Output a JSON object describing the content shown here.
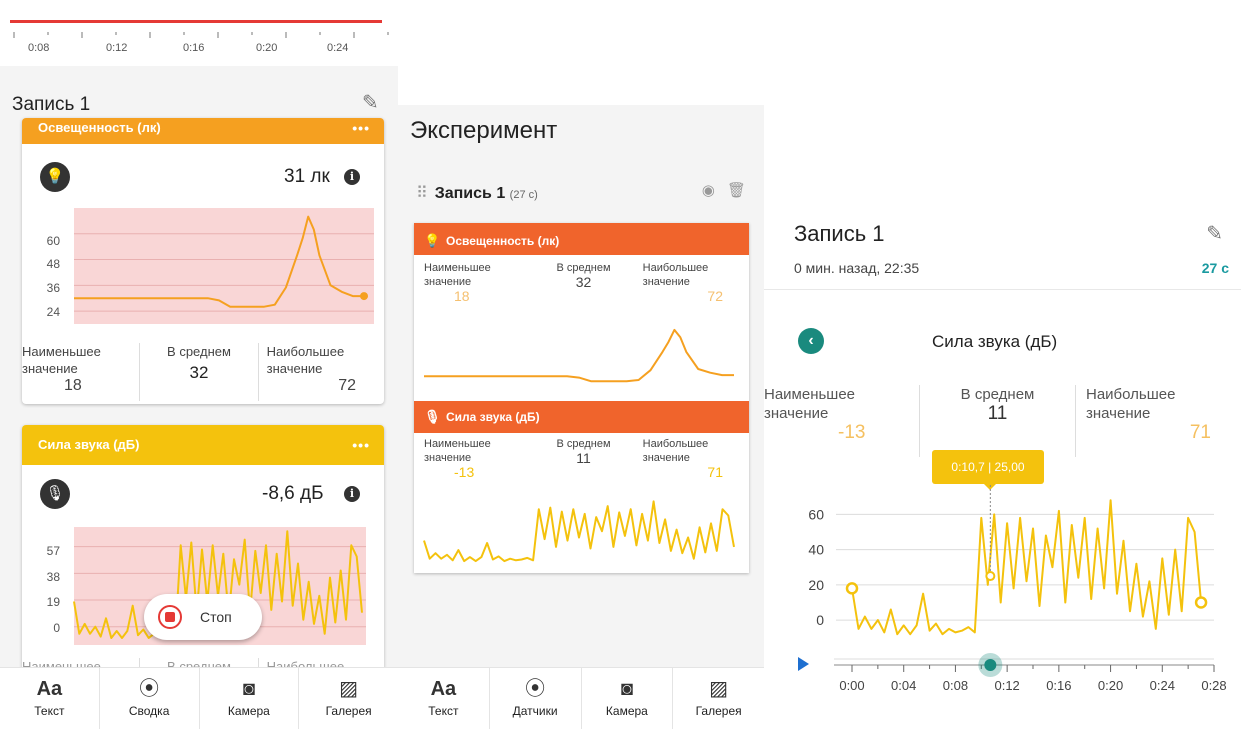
{
  "colors": {
    "light_orange": "#f5a020",
    "light_line": "#f5a020",
    "sound_yellow": "#f4c20d",
    "sound_line": "#f4c20d",
    "alert_band": "#f9d6d6",
    "section_orange": "#f0642c",
    "teal": "#1a8a7e",
    "record_red": "#e53935"
  },
  "panel1": {
    "timeline_ticks": [
      "0:08",
      "0:12",
      "0:16",
      "0:20",
      "0:24"
    ],
    "recording_title": "Запись 1",
    "light_card": {
      "title": "Освещенность (лк)",
      "menu": "•••",
      "icon": "lightbulb-icon",
      "reading": "31 лк",
      "y_ticks": [
        "60",
        "48",
        "36",
        "24"
      ],
      "stats": [
        {
          "label": "Наименьшее значение",
          "value": "18"
        },
        {
          "label": "В среднем",
          "value": "32"
        },
        {
          "label": "Наибольшее значение",
          "value": "72"
        }
      ]
    },
    "sound_card": {
      "title": "Сила звука (дБ)",
      "menu": "•••",
      "icon": "microphone-icon",
      "reading": "-8,6 дБ",
      "y_ticks": [
        "57",
        "38",
        "19",
        "0"
      ],
      "stats": [
        {
          "label": "Наименьшее",
          "value": ""
        },
        {
          "label": "В среднем",
          "value": ""
        },
        {
          "label": "Наибольшее",
          "value": ""
        }
      ]
    },
    "stop_button": "Стоп",
    "tabs": [
      {
        "icon": "text-icon",
        "glyph": "Aa",
        "label": "Текст"
      },
      {
        "icon": "sensor-summary-icon",
        "glyph": "⦿",
        "label": "Сводка"
      },
      {
        "icon": "camera-icon",
        "glyph": "◙",
        "label": "Камера"
      },
      {
        "icon": "gallery-icon",
        "glyph": "▨",
        "label": "Галерея"
      }
    ]
  },
  "panel2": {
    "title": "Эксперимент",
    "recording_title": "Запись 1",
    "recording_duration": "(27 с)",
    "light_section": {
      "title": "Освещенность (лк)",
      "stats": [
        {
          "label": "Наименьшее значение",
          "value": "18"
        },
        {
          "label": "В среднем",
          "value": "32"
        },
        {
          "label": "Наибольшее значение",
          "value": "72"
        }
      ]
    },
    "sound_section": {
      "title": "Сила звука (дБ)",
      "stats": [
        {
          "label": "Наименьшее значение",
          "value": "-13"
        },
        {
          "label": "В среднем",
          "value": "11"
        },
        {
          "label": "Наибольшее значение",
          "value": "71"
        }
      ]
    },
    "tabs": [
      {
        "icon": "text-icon",
        "glyph": "Aa",
        "label": "Текст"
      },
      {
        "icon": "sensors-icon",
        "glyph": "⦿",
        "label": "Датчики"
      },
      {
        "icon": "camera-icon",
        "glyph": "◙",
        "label": "Камера"
      },
      {
        "icon": "gallery-icon",
        "glyph": "▨",
        "label": "Галерея"
      }
    ]
  },
  "panel3": {
    "recording_title": "Запись 1",
    "subtitle": "0 мин. назад, 22:35",
    "duration": "27 с",
    "chart_title": "Сила звука (дБ)",
    "stats": [
      {
        "label": "Наименьшее значение",
        "value": "-13"
      },
      {
        "label": "В среднем",
        "value": "11"
      },
      {
        "label": "Наибольшее значение",
        "value": "71"
      }
    ],
    "tooltip": "0:10,7  |  25,00"
  },
  "chart_data": [
    {
      "type": "line",
      "title": "Освещенность (лк)",
      "x_unit": "s",
      "ylim": [
        18,
        72
      ],
      "y_ticks": [
        24,
        36,
        48,
        60
      ],
      "x": [
        0,
        4,
        8,
        10,
        12,
        13,
        14,
        15,
        16,
        17,
        18,
        19,
        20,
        20.5,
        21,
        21.5,
        22,
        23,
        24,
        25,
        26
      ],
      "values": [
        30,
        30,
        30,
        30,
        30,
        29,
        26,
        26,
        26,
        26,
        27,
        35,
        50,
        58,
        68,
        62,
        50,
        36,
        33,
        31,
        31
      ],
      "current_value": 31
    },
    {
      "type": "line",
      "title": "Сила звука (дБ)",
      "x_unit": "s",
      "xlim": [
        0,
        28
      ],
      "x_ticks": [
        "0:00",
        "0:04",
        "0:08",
        "0:12",
        "0:16",
        "0:20",
        "0:24",
        "0:28"
      ],
      "ylim": [
        -13,
        71
      ],
      "y_ticks": [
        0,
        20,
        40,
        60
      ],
      "x": [
        0,
        0.5,
        1,
        1.5,
        2,
        2.5,
        3,
        3.5,
        4,
        4.5,
        5,
        5.5,
        6,
        6.5,
        7,
        7.5,
        8,
        8.5,
        9,
        9.5,
        10,
        10.5,
        11,
        11.5,
        12,
        12.5,
        13,
        13.5,
        14,
        14.5,
        15,
        15.5,
        16,
        16.5,
        17,
        17.5,
        18,
        18.5,
        19,
        19.5,
        20,
        20.5,
        21,
        21.5,
        22,
        22.5,
        23,
        23.5,
        24,
        24.5,
        25,
        25.5,
        26,
        26.5,
        27
      ],
      "values": [
        18,
        -5,
        2,
        -5,
        0,
        -7,
        6,
        -8,
        -3,
        -8,
        -3,
        15,
        -6,
        -2,
        -8,
        -5,
        -7,
        -6,
        -4,
        -7,
        58,
        20,
        60,
        10,
        55,
        18,
        58,
        22,
        52,
        8,
        48,
        30,
        62,
        10,
        54,
        24,
        58,
        12,
        52,
        18,
        68,
        15,
        45,
        5,
        32,
        2,
        22,
        -5,
        35,
        3,
        40,
        5,
        58,
        50,
        10
      ],
      "highlight": {
        "x": 10.7,
        "y": 25.0,
        "label": "0:10,7 | 25,00"
      }
    }
  ]
}
